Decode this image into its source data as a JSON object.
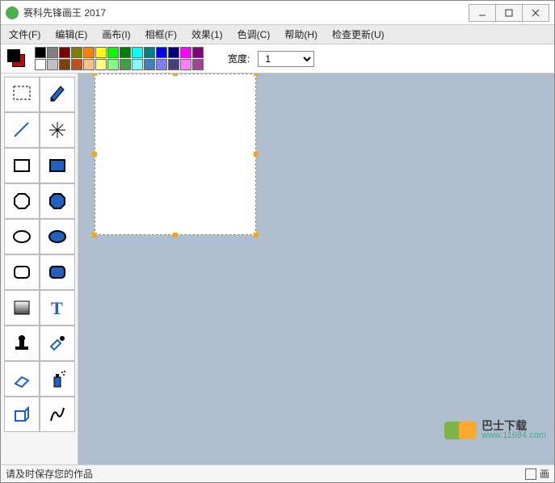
{
  "window": {
    "title": "赛科先锋画王 2017"
  },
  "menu": {
    "file": "文件(F)",
    "edit": "编辑(E)",
    "canvas": "画布(I)",
    "frame": "相框(F)",
    "effect": "效果(1)",
    "tone": "色调(C)",
    "help": "帮助(H)",
    "update": "检查更新(U)"
  },
  "palette": {
    "row1": [
      "#000000",
      "#808080",
      "#800000",
      "#808000",
      "#ff8000",
      "#ffff00",
      "#00ff00",
      "#008000",
      "#00ffff",
      "#008080",
      "#0000ff",
      "#000080",
      "#ff00ff",
      "#800080"
    ],
    "row2": [
      "#ffffff",
      "#c0c0c0",
      "#804000",
      "#c05020",
      "#ffc080",
      "#ffff80",
      "#80ff80",
      "#40a040",
      "#80ffff",
      "#4080c0",
      "#8080ff",
      "#404080",
      "#ff80ff",
      "#a040a0"
    ]
  },
  "widthbar": {
    "label": "宽度:",
    "value": "1"
  },
  "tools": {
    "select": "select",
    "pencil": "pencil",
    "line": "line",
    "star": "star",
    "rect_outline": "rect-outline",
    "rect_filled": "rect-filled",
    "oct_outline": "oct-outline",
    "oct_filled": "oct-filled",
    "ellipse_outline": "ellipse-outline",
    "ellipse_filled": "ellipse-filled",
    "roundrect_outline": "roundrect-outline",
    "roundrect_filled": "roundrect-filled",
    "gradient": "gradient",
    "text": "text",
    "stamp": "stamp",
    "picker": "picker",
    "eraser": "eraser",
    "spray": "spray",
    "shape3d": "shape3d",
    "curve": "curve"
  },
  "status": {
    "hint": "请及时保存您的作品",
    "right": "画"
  },
  "watermark": {
    "name": "巴士下载",
    "url": "www.11684.com"
  }
}
